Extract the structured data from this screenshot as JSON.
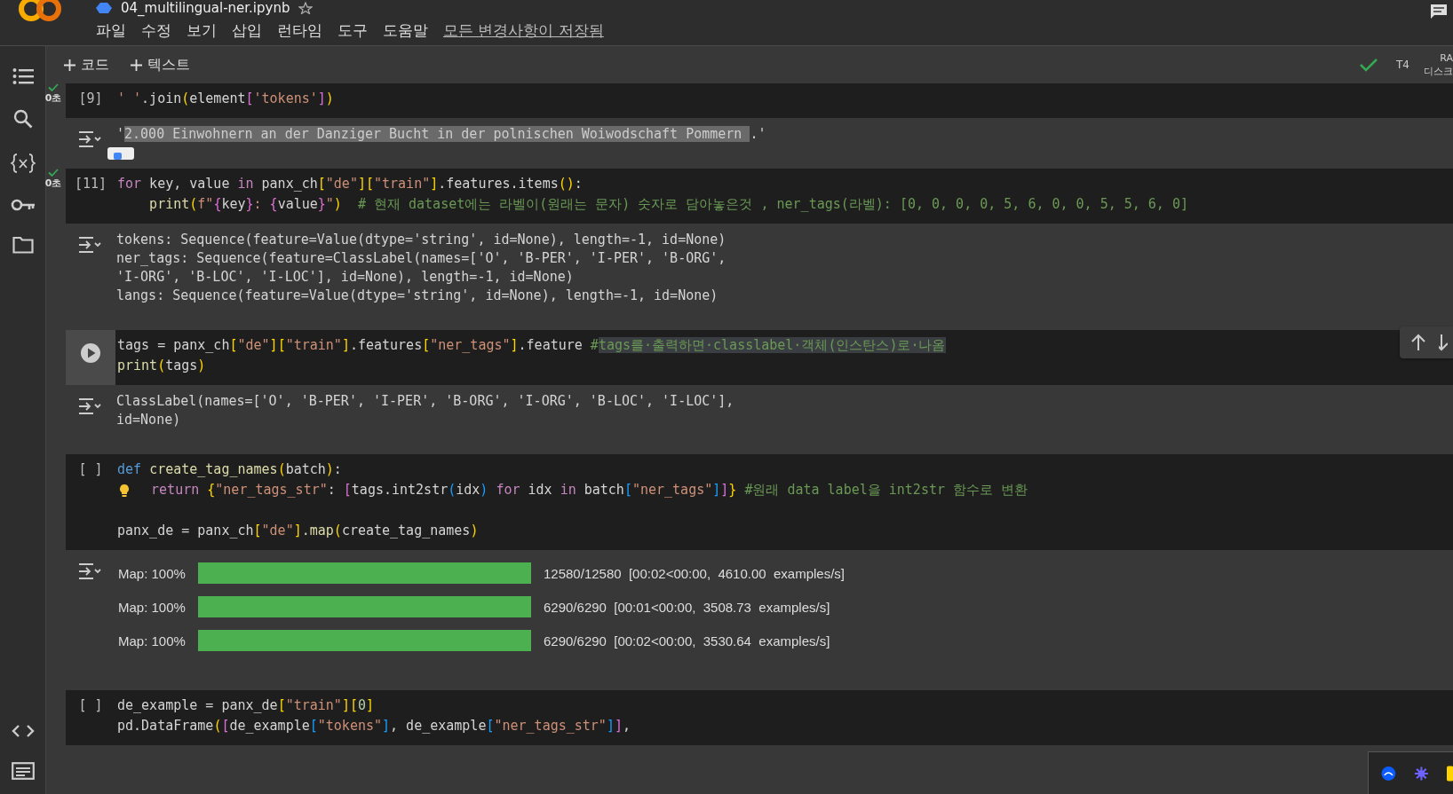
{
  "notebook": {
    "title": "04_multilingual-ner.ipynb",
    "menu": [
      "파일",
      "수정",
      "보기",
      "삽입",
      "런타임",
      "도구",
      "도움말"
    ],
    "save_status": "모든 변경사항이 저장됨"
  },
  "toolbar": {
    "add_buttons": [
      "코드",
      "텍스트"
    ],
    "runtime": "T4",
    "resources": [
      "RA",
      "디스크"
    ]
  },
  "cells": [
    {
      "kind": "counted",
      "label": "[9]",
      "executed": true,
      "time": "0초",
      "lines": [
        {
          "kind": "code",
          "tokens": [
            {
              "t": "' '",
              "kind": "s"
            },
            {
              "t": ".join",
              "kind": "p"
            },
            {
              "t": "(",
              "kind": "b1"
            },
            {
              "t": "element",
              "kind": "p"
            },
            {
              "t": "[",
              "kind": "b2"
            },
            {
              "t": "'tokens'",
              "kind": "s"
            },
            {
              "t": "]",
              "kind": "b2"
            },
            {
              "t": ")",
              "kind": "b1"
            }
          ]
        }
      ],
      "output": {
        "kind": "text",
        "lines": [
          [
            {
              "t": "'",
              "kind": "o"
            },
            {
              "t": "2.000 Einwohnern an der Danziger Bucht in der polnischen Woiwodschaft Pommern ",
              "kind": "sel"
            },
            {
              "t": ".'",
              "kind": "o"
            }
          ]
        ]
      }
    },
    {
      "kind": "counted",
      "label": "[11]",
      "executed": true,
      "time": "0초",
      "lines": [
        {
          "kind": "code",
          "tokens": [
            {
              "t": "for",
              "kind": "kw"
            },
            {
              "t": " key, value ",
              "kind": "p"
            },
            {
              "t": "in",
              "kind": "kw"
            },
            {
              "t": " panx_ch",
              "kind": "p"
            },
            {
              "t": "[",
              "kind": "b1"
            },
            {
              "t": "\"de\"",
              "kind": "s"
            },
            {
              "t": "]",
              "kind": "b1"
            },
            {
              "t": "[",
              "kind": "b1"
            },
            {
              "t": "\"train\"",
              "kind": "s"
            },
            {
              "t": "]",
              "kind": "b1"
            },
            {
              "t": ".features.items",
              "kind": "p"
            },
            {
              "t": "()",
              "kind": "b1"
            },
            {
              "t": ":",
              "kind": "p"
            }
          ]
        },
        {
          "kind": "code",
          "tokens": [
            {
              "t": "    print",
              "kind": "fn"
            },
            {
              "t": "(",
              "kind": "b1"
            },
            {
              "t": "f\"",
              "kind": "s"
            },
            {
              "t": "{",
              "kind": "b2"
            },
            {
              "t": "key",
              "kind": "p"
            },
            {
              "t": "}",
              "kind": "b2"
            },
            {
              "t": ": ",
              "kind": "s"
            },
            {
              "t": "{",
              "kind": "b2"
            },
            {
              "t": "value",
              "kind": "p"
            },
            {
              "t": "}",
              "kind": "b2"
            },
            {
              "t": "\"",
              "kind": "s"
            },
            {
              "t": ")",
              "kind": "b1"
            },
            {
              "t": "  # 현재 dataset에는 라벨이(원래는 문자) 숫자로 담아놓은것 , ner_tags(라벨): [0, 0, 0, 0, 5, 6, 0, 0, 5, 5, 6, 0]",
              "kind": "c"
            }
          ]
        }
      ],
      "output": {
        "kind": "text",
        "lines": [
          [
            {
              "t": "tokens: Sequence(feature=Value(dtype='string', id=None), length=-1, id=None)",
              "kind": "o"
            }
          ],
          [
            {
              "t": "ner_tags: Sequence(feature=ClassLabel(names=['O', 'B-PER', 'I-PER', 'B-ORG',",
              "kind": "o"
            }
          ],
          [
            {
              "t": "'I-ORG', 'B-LOC', 'I-LOC'], id=None), length=-1, id=None)",
              "kind": "o"
            }
          ],
          [
            {
              "t": "langs: Sequence(feature=Value(dtype='string', id=None), length=-1, id=None)",
              "kind": "o"
            }
          ]
        ]
      }
    },
    {
      "kind": "hovered",
      "executed": false,
      "lines": [
        {
          "kind": "code",
          "tokens": [
            {
              "t": "tags = panx_ch",
              "kind": "p"
            },
            {
              "t": "[",
              "kind": "b1"
            },
            {
              "t": "\"de\"",
              "kind": "s"
            },
            {
              "t": "]",
              "kind": "b1"
            },
            {
              "t": "[",
              "kind": "b1"
            },
            {
              "t": "\"train\"",
              "kind": "s"
            },
            {
              "t": "]",
              "kind": "b1"
            },
            {
              "t": ".features",
              "kind": "p"
            },
            {
              "t": "[",
              "kind": "b1"
            },
            {
              "t": "\"ner_tags\"",
              "kind": "s"
            },
            {
              "t": "]",
              "kind": "b1"
            },
            {
              "t": ".feature ",
              "kind": "p"
            },
            {
              "t": "#",
              "kind": "c"
            },
            {
              "t": "tags를·출력하면·classlabel·객체(인스탄스)로·나옴",
              "kind": "csel"
            }
          ]
        },
        {
          "kind": "code",
          "tokens": [
            {
              "t": "print",
              "kind": "fn"
            },
            {
              "t": "(",
              "kind": "b1"
            },
            {
              "t": "tags",
              "kind": "p"
            },
            {
              "t": ")",
              "kind": "b1"
            }
          ]
        }
      ],
      "output": {
        "kind": "text",
        "lines": [
          [
            {
              "t": "ClassLabel(names=['O', 'B-PER', 'I-PER', 'B-ORG', 'I-ORG', 'B-LOC', 'I-LOC'],",
              "kind": "o"
            }
          ],
          [
            {
              "t": "id=None)",
              "kind": "o"
            }
          ]
        ]
      }
    },
    {
      "kind": "counted",
      "label": "[ ]",
      "executed": false,
      "lines": [
        {
          "kind": "code",
          "tokens": [
            {
              "t": "def ",
              "kind": "def"
            },
            {
              "t": "create_tag_names",
              "kind": "fn"
            },
            {
              "t": "(",
              "kind": "b1"
            },
            {
              "t": "batch",
              "kind": "p"
            },
            {
              "t": ")",
              "kind": "b1"
            },
            {
              "t": ":",
              "kind": "p"
            }
          ]
        },
        {
          "kind": "code",
          "hint": true,
          "tokens": [
            {
              "t": "  return ",
              "kind": "kw"
            },
            {
              "t": "{",
              "kind": "b1"
            },
            {
              "t": "\"ner_tags_str\"",
              "kind": "s"
            },
            {
              "t": ": ",
              "kind": "p"
            },
            {
              "t": "[",
              "kind": "b2"
            },
            {
              "t": "tags.int2str",
              "kind": "p"
            },
            {
              "t": "(",
              "kind": "b3"
            },
            {
              "t": "idx",
              "kind": "p"
            },
            {
              "t": ") ",
              "kind": "b3"
            },
            {
              "t": "for",
              "kind": "kw"
            },
            {
              "t": " idx ",
              "kind": "p"
            },
            {
              "t": "in",
              "kind": "kw"
            },
            {
              "t": " batch",
              "kind": "p"
            },
            {
              "t": "[",
              "kind": "b3"
            },
            {
              "t": "\"ner_tags\"",
              "kind": "s"
            },
            {
              "t": "]",
              "kind": "b3"
            },
            {
              "t": "]",
              "kind": "b2"
            },
            {
              "t": "} ",
              "kind": "b1"
            },
            {
              "t": "#원래 data label을 int2str 함수로 변환",
              "kind": "c"
            }
          ]
        },
        {
          "kind": "blank"
        },
        {
          "kind": "code",
          "tokens": [
            {
              "t": "panx_de = panx_ch",
              "kind": "p"
            },
            {
              "t": "[",
              "kind": "b1"
            },
            {
              "t": "\"de\"",
              "kind": "s"
            },
            {
              "t": "]",
              "kind": "b1"
            },
            {
              "t": ".",
              "kind": "p"
            },
            {
              "t": "map",
              "kind": "fn"
            },
            {
              "t": "(",
              "kind": "b1"
            },
            {
              "t": "create_tag_names",
              "kind": "p"
            },
            {
              "t": ")",
              "kind": "b1"
            }
          ]
        }
      ],
      "output": {
        "kind": "progress",
        "bars": [
          {
            "label": "Map: 100%",
            "level": 1,
            "stats": "12580/12580  [00:02<00:00,  4610.00  examples/s]"
          },
          {
            "label": "Map: 100%",
            "level": 1,
            "stats": "6290/6290  [00:01<00:00,  3508.73  examples/s]"
          },
          {
            "label": "Map: 100%",
            "level": 1,
            "stats": "6290/6290  [00:02<00:00,  3530.64  examples/s]"
          }
        ]
      }
    },
    {
      "kind": "counted",
      "label": "[ ]",
      "executed": false,
      "lines": [
        {
          "kind": "code",
          "tokens": [
            {
              "t": "de_example = panx_de",
              "kind": "p"
            },
            {
              "t": "[",
              "kind": "b1"
            },
            {
              "t": "\"train\"",
              "kind": "s"
            },
            {
              "t": "]",
              "kind": "b1"
            },
            {
              "t": "[",
              "kind": "b1"
            },
            {
              "t": "0",
              "kind": "n"
            },
            {
              "t": "]",
              "kind": "b1"
            }
          ]
        },
        {
          "kind": "code",
          "tokens": [
            {
              "t": "pd.DataFrame",
              "kind": "p"
            },
            {
              "t": "(",
              "kind": "b1"
            },
            {
              "t": "[",
              "kind": "b2"
            },
            {
              "t": "de_example",
              "kind": "p"
            },
            {
              "t": "[",
              "kind": "b3"
            },
            {
              "t": "\"tokens\"",
              "kind": "s"
            },
            {
              "t": "]",
              "kind": "b3"
            },
            {
              "t": ", de_example",
              "kind": "p"
            },
            {
              "t": "[",
              "kind": "b3"
            },
            {
              "t": "\"ner_tags_str\"",
              "kind": "s"
            },
            {
              "t": "]",
              "kind": "b3"
            },
            {
              "t": "]",
              "kind": "b2"
            },
            {
              "t": ",",
              "kind": "p"
            }
          ]
        }
      ]
    }
  ]
}
